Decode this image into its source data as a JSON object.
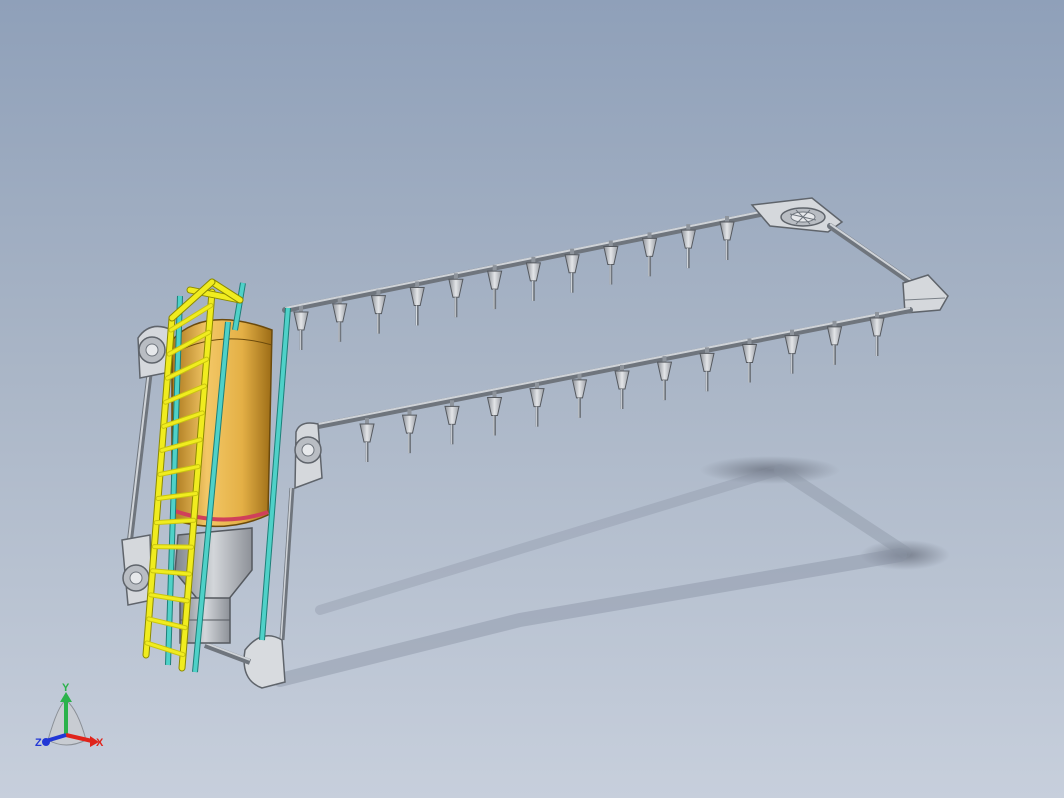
{
  "viewport": {
    "background_top": "#8fa0b9",
    "background_bottom": "#c7cfdc"
  },
  "colors": {
    "pipe": "#8e949c",
    "pipe_highlight": "#d9dde2",
    "nozzle": "#c9ccd1",
    "ladder": "#f0ec1f",
    "ladder_edge": "#8c8a00",
    "post": "#4fd1c8",
    "post_edge": "#1d7f78",
    "tank": "#e4b046",
    "tank_dark": "#a9761c",
    "hopper": "#aeb2b8",
    "strap": "#d0405a",
    "shadow": "#7d8593",
    "axis_x": "#e0241b",
    "axis_y": "#2bb24a",
    "axis_z": "#2237d6"
  },
  "model": {
    "icons": [
      "ladder",
      "water-tank",
      "hopper",
      "pipe-loop",
      "sprinkler-nozzle",
      "pulley"
    ],
    "nozzles_back_row": 12,
    "nozzles_front_row": 13
  },
  "triad": {
    "x_label": "X",
    "y_label": "Y",
    "z_label": "Z"
  }
}
